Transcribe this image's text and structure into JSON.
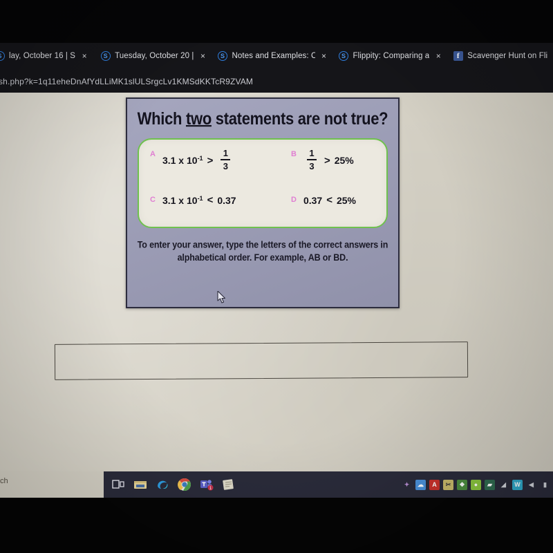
{
  "browser": {
    "tabs": [
      {
        "favicon": "schoology-s-icon",
        "title": "lay, October 16 | S",
        "close_label": "×"
      },
      {
        "favicon": "schoology-s-icon",
        "title": "Tuesday, October 20 |",
        "close_label": "×"
      },
      {
        "favicon": "schoology-s-icon",
        "title": "Notes and Examples: C",
        "close_label": "×"
      },
      {
        "favicon": "schoology-s-icon",
        "title": "Flippity: Comparing a",
        "close_label": "×"
      },
      {
        "favicon": "facebook-icon",
        "title": "Scavenger Hunt on Fli",
        "close_label": "×"
      }
    ],
    "address_bar": {
      "url": "sh.php?k=1q11eheDnAfYdLLiMK1slULSrgcLv1KMSdKKTcR9ZVAM"
    },
    "favicon_glyphs": {
      "schoology-s-icon": "S",
      "facebook-icon": "f"
    }
  },
  "slide": {
    "title_before": "Which ",
    "title_underlined": "two",
    "title_after": " statements are not true?",
    "options": [
      {
        "letter": "A",
        "left_value": "3.1 x 10",
        "left_exponent": "-1",
        "comparator": ">",
        "right_numerator": "1",
        "right_denominator": "3",
        "right_plain": ""
      },
      {
        "letter": "B",
        "left_value": "",
        "left_exponent": "",
        "comparator": ">",
        "right_numerator": "1",
        "right_denominator": "3",
        "right_plain": "25%"
      },
      {
        "letter": "C",
        "left_value": "3.1 x 10",
        "left_exponent": "-1",
        "comparator": "<",
        "right_numerator": "",
        "right_denominator": "",
        "right_plain": "0.37"
      },
      {
        "letter": "D",
        "left_value": "0.37",
        "left_exponent": "",
        "comparator": "<",
        "right_numerator": "",
        "right_denominator": "",
        "right_plain": "25%"
      }
    ],
    "instructions_line1": "To enter your answer, type the letters of the correct answers in",
    "instructions_line2": "alphabetical order.  For example, AB or BD.",
    "colors": {
      "slide_background": "#9b9cb7",
      "answer_panel_background": "#ece9e0",
      "answer_panel_border": "#6fc14e",
      "option_letter": "#e07fd2",
      "text": "#15141d"
    }
  },
  "answer_field": {
    "value": "",
    "placeholder": ""
  },
  "key_hint": {
    "icon": "key-icon"
  },
  "taskbar": {
    "search_text": "ch",
    "apps": [
      {
        "name": "task-view-icon",
        "glyph": "⧉",
        "color": "#e8e8ef",
        "bg": "transparent"
      },
      {
        "name": "file-explorer-icon",
        "glyph": "▤",
        "color": "#f2c14e",
        "bg": "transparent"
      },
      {
        "name": "edge-icon",
        "glyph": "e",
        "color": "#35a3e0",
        "bg": "transparent"
      },
      {
        "name": "chrome-icon",
        "glyph": "●",
        "color": "#7fbf6a",
        "bg": "transparent"
      },
      {
        "name": "teams-icon",
        "glyph": "■",
        "color": "#6264a7",
        "bg": "transparent"
      },
      {
        "name": "sticky-notes-icon",
        "glyph": "▧",
        "color": "#ded8c4",
        "bg": "transparent"
      }
    ],
    "tray": [
      {
        "name": "show-hidden-icons",
        "glyph": "✦",
        "bg": "transparent",
        "color": "#b98fd4"
      },
      {
        "name": "onedrive-icon",
        "glyph": "☁",
        "bg": "#4a90d9",
        "color": "#ffffff"
      },
      {
        "name": "adobe-reader-icon",
        "glyph": "A",
        "bg": "#c8312b",
        "color": "#ffffff"
      },
      {
        "name": "snipping-tool-icon",
        "glyph": "✂",
        "bg": "#c7b96a",
        "color": "#3a3a3a"
      },
      {
        "name": "security-icon",
        "glyph": "❖",
        "bg": "#4c8c3f",
        "color": "#ffffff"
      },
      {
        "name": "antivirus-icon",
        "glyph": "●",
        "bg": "#8ac53e",
        "color": "#ffffff"
      },
      {
        "name": "vpn-icon",
        "glyph": "▰",
        "bg": "#2f6b4f",
        "color": "#ffffff"
      },
      {
        "name": "wifi-icon",
        "glyph": "◢",
        "bg": "transparent",
        "color": "#cfd2d8"
      },
      {
        "name": "weather-icon",
        "glyph": "W",
        "bg": "#2fa8c8",
        "color": "#ffffff"
      },
      {
        "name": "volume-icon",
        "glyph": "◀",
        "bg": "transparent",
        "color": "#cfd2d8"
      },
      {
        "name": "battery-icon",
        "glyph": "▮",
        "bg": "transparent",
        "color": "#cfd2d8"
      }
    ]
  }
}
